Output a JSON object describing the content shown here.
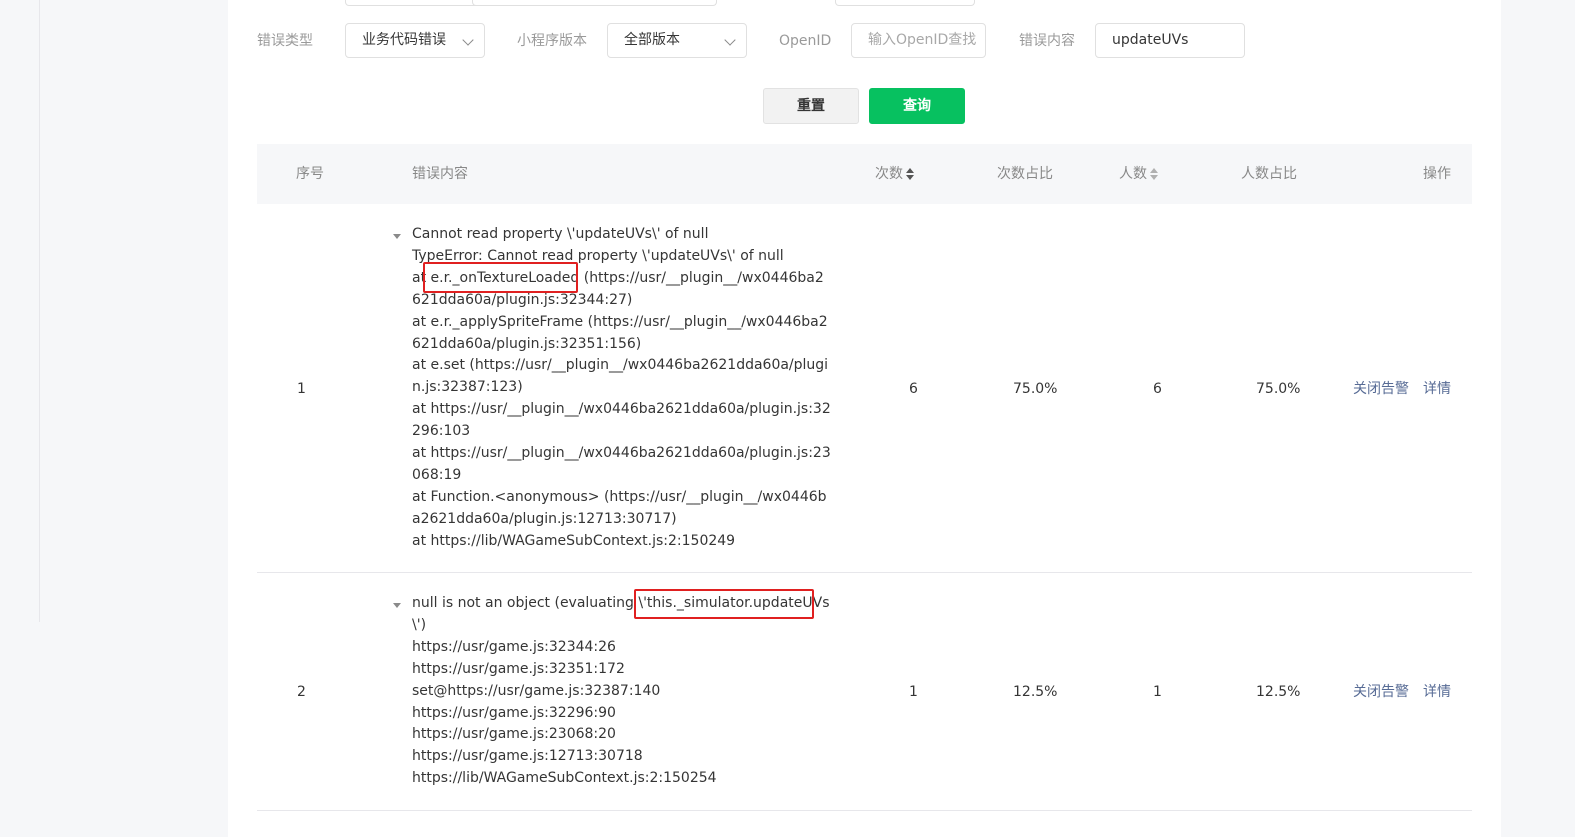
{
  "filters": {
    "error_type": {
      "label": "错误类型",
      "value": "业务代码错误"
    },
    "version": {
      "label": "小程序版本",
      "value": "全部版本"
    },
    "openid": {
      "label": "OpenID",
      "placeholder": "输入OpenID查找"
    },
    "error_content": {
      "label": "错误内容",
      "value": "updateUVs"
    }
  },
  "buttons": {
    "reset": "重置",
    "query": "查询"
  },
  "table": {
    "headers": {
      "index": "序号",
      "content": "错误内容",
      "count": "次数",
      "count_ratio": "次数占比",
      "users": "人数",
      "user_ratio": "人数占比",
      "ops": "操作"
    },
    "rows": [
      {
        "index": "1",
        "lines": [
          "Cannot read property \\'updateUVs\\' of null",
          "TypeError: Cannot read property \\'updateUVs\\' of null",
          "at e.r._onTextureLoaded (https://usr/__plugin__/wx0446ba2",
          "621dda60a/plugin.js:32344:27)",
          "at e.r._applySpriteFrame (https://usr/__plugin__/wx0446ba2",
          "621dda60a/plugin.js:32351:156)",
          "at e.set (https://usr/__plugin__/wx0446ba2621dda60a/plugi",
          "n.js:32387:123)",
          "at https://usr/__plugin__/wx0446ba2621dda60a/plugin.js:32",
          "296:103",
          "at https://usr/__plugin__/wx0446ba2621dda60a/plugin.js:23",
          "068:19",
          "at Function.<anonymous> (https://usr/__plugin__/wx0446b",
          "a2621dda60a/plugin.js:12713:30717)",
          "at https://lib/WAGameSubContext.js:2:150249"
        ],
        "count": "6",
        "count_ratio": "75.0%",
        "users": "6",
        "user_ratio": "75.0%",
        "op_close": "关闭告警",
        "op_detail": "详情"
      },
      {
        "index": "2",
        "lines": [
          "null is not an object (evaluating \\'this._simulator.updateUVs",
          "\\')",
          "https://usr/game.js:32344:26",
          "https://usr/game.js:32351:172",
          "set@https://usr/game.js:32387:140",
          "https://usr/game.js:32296:90",
          "https://usr/game.js:23068:20",
          "https://usr/game.js:12713:30718",
          "https://lib/WAGameSubContext.js:2:150254"
        ],
        "count": "1",
        "count_ratio": "12.5%",
        "users": "1",
        "user_ratio": "12.5%",
        "op_close": "关闭告警",
        "op_detail": "详情"
      }
    ]
  },
  "colors": {
    "primary": "#07c160",
    "link": "#576b95",
    "highlight": "#e02020"
  }
}
